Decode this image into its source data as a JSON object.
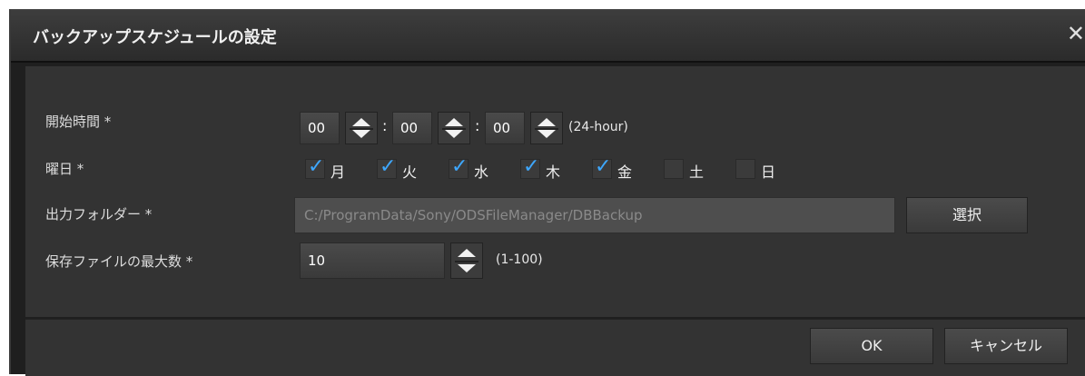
{
  "dialog": {
    "title": "バックアップスケジュールの設定",
    "close_glyph": "✕"
  },
  "start_time": {
    "label": "開始時間 *",
    "hour": "00",
    "minute": "00",
    "second": "00",
    "separator": ":",
    "hint": "(24-hour)"
  },
  "weekday": {
    "label": "曜日 *",
    "days": [
      {
        "label": "月",
        "checked": true
      },
      {
        "label": "火",
        "checked": true
      },
      {
        "label": "水",
        "checked": true
      },
      {
        "label": "木",
        "checked": true
      },
      {
        "label": "金",
        "checked": true
      },
      {
        "label": "土",
        "checked": false
      },
      {
        "label": "日",
        "checked": false
      }
    ]
  },
  "output_folder": {
    "label": "出力フォルダー *",
    "value": "C:/ProgramData/Sony/ODSFileManager/DBBackup",
    "select_button": "選択"
  },
  "max_files": {
    "label": "保存ファイルの最大数 *",
    "value": "10",
    "hint": "(1-100)"
  },
  "footer": {
    "ok_button": "OK",
    "cancel_button": "キャンセル"
  },
  "colors": {
    "accent": "#3ea8ff",
    "background": "#333333"
  }
}
